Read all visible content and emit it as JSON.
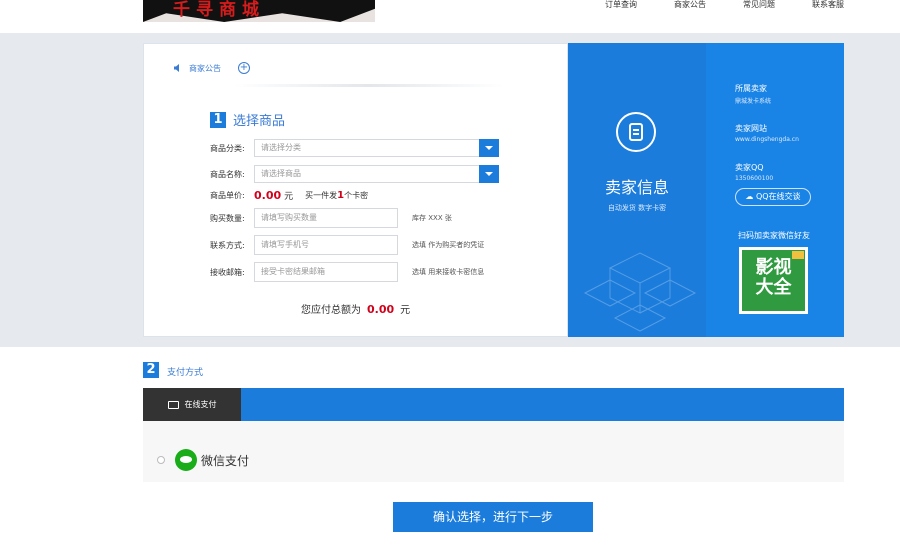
{
  "header": {
    "logo_text": "千寻商城",
    "nav": [
      "订单查询",
      "商家公告",
      "常见问题",
      "联系客服"
    ]
  },
  "form": {
    "notice_label": "商家公告",
    "step1_num": "1",
    "step1_title": "选择商品",
    "category_label": "商品分类:",
    "category_placeholder": "请选择分类",
    "product_label": "商品名称:",
    "product_placeholder": "请选择商品",
    "price_label": "商品单价:",
    "price_value": "0.00",
    "price_unit": "元",
    "wholesale_prefix": "买一件发",
    "wholesale_count": "1",
    "wholesale_suffix": "个卡密",
    "qty_label": "购买数量:",
    "qty_placeholder": "请填写购买数量",
    "qty_hint": "库存 XXX 张",
    "contact_label": "联系方式:",
    "contact_placeholder": "请填写手机号",
    "contact_hint": "选填 作为购买者的凭证",
    "email_label": "接收邮箱:",
    "email_placeholder": "接受卡密结果邮箱",
    "email_hint": "选填 用来接收卡密信息",
    "total_label": "您应付总额为",
    "total_value": "0.00",
    "total_unit": "元"
  },
  "seller": {
    "title": "卖家信息",
    "tags": "自动发货   数字卡密",
    "store_label": "所属卖家",
    "store_value": "鼎城发卡系统",
    "site_label": "卖家网站",
    "site_value": "www.dingshengda.cn",
    "qq_label": "卖家QQ",
    "qq_value": "1350600100",
    "qq_button": "QQ在线交谈",
    "scan_label": "扫码加卖家微信好友",
    "qr_text_line1": "影视",
    "qr_text_line2": "大全"
  },
  "payment": {
    "step2_num": "2",
    "step2_title": "支付方式",
    "tab_label": "在线支付",
    "option_label": "微信支付"
  },
  "confirm_button": "确认选择，进行下一步",
  "colors": {
    "primary": "#1b7cdc",
    "price": "#d0021b",
    "dark_tab": "#333333",
    "wechat": "#1aad19"
  }
}
